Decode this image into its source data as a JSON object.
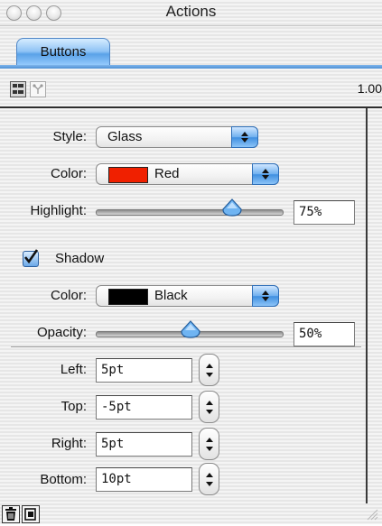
{
  "window": {
    "title": "Actions"
  },
  "tabs": [
    {
      "label": "Buttons",
      "selected": true
    }
  ],
  "toolbar": {
    "left_icon": "list-view-icon",
    "right_icon": "hierarchy-view-icon",
    "version": "1.00"
  },
  "button_settings": {
    "style_label": "Style:",
    "style_value": "Glass",
    "color_label": "Color:",
    "color_value": "Red",
    "color_swatch": "#f02000",
    "highlight_label": "Highlight:",
    "highlight_value": "75%",
    "highlight_level": 0.75
  },
  "shadow": {
    "checkbox_label": "Shadow",
    "checked": true,
    "color_label": "Color:",
    "color_value": "Black",
    "color_swatch": "#000000",
    "opacity_label": "Opacity:",
    "opacity_value": "50%",
    "opacity_level": 0.5,
    "left_label": "Left:",
    "left_value": "5pt",
    "top_label": "Top:",
    "top_value": "-5pt",
    "right_label": "Right:",
    "right_value": "5pt",
    "bottom_label": "Bottom:",
    "bottom_value": "10pt"
  },
  "bottom_bar": {
    "delete_icon": "trash-icon",
    "new_icon": "new-item-icon"
  },
  "colors": {
    "accent": "#5aa2e8",
    "thumb": "#6fb4f2"
  }
}
